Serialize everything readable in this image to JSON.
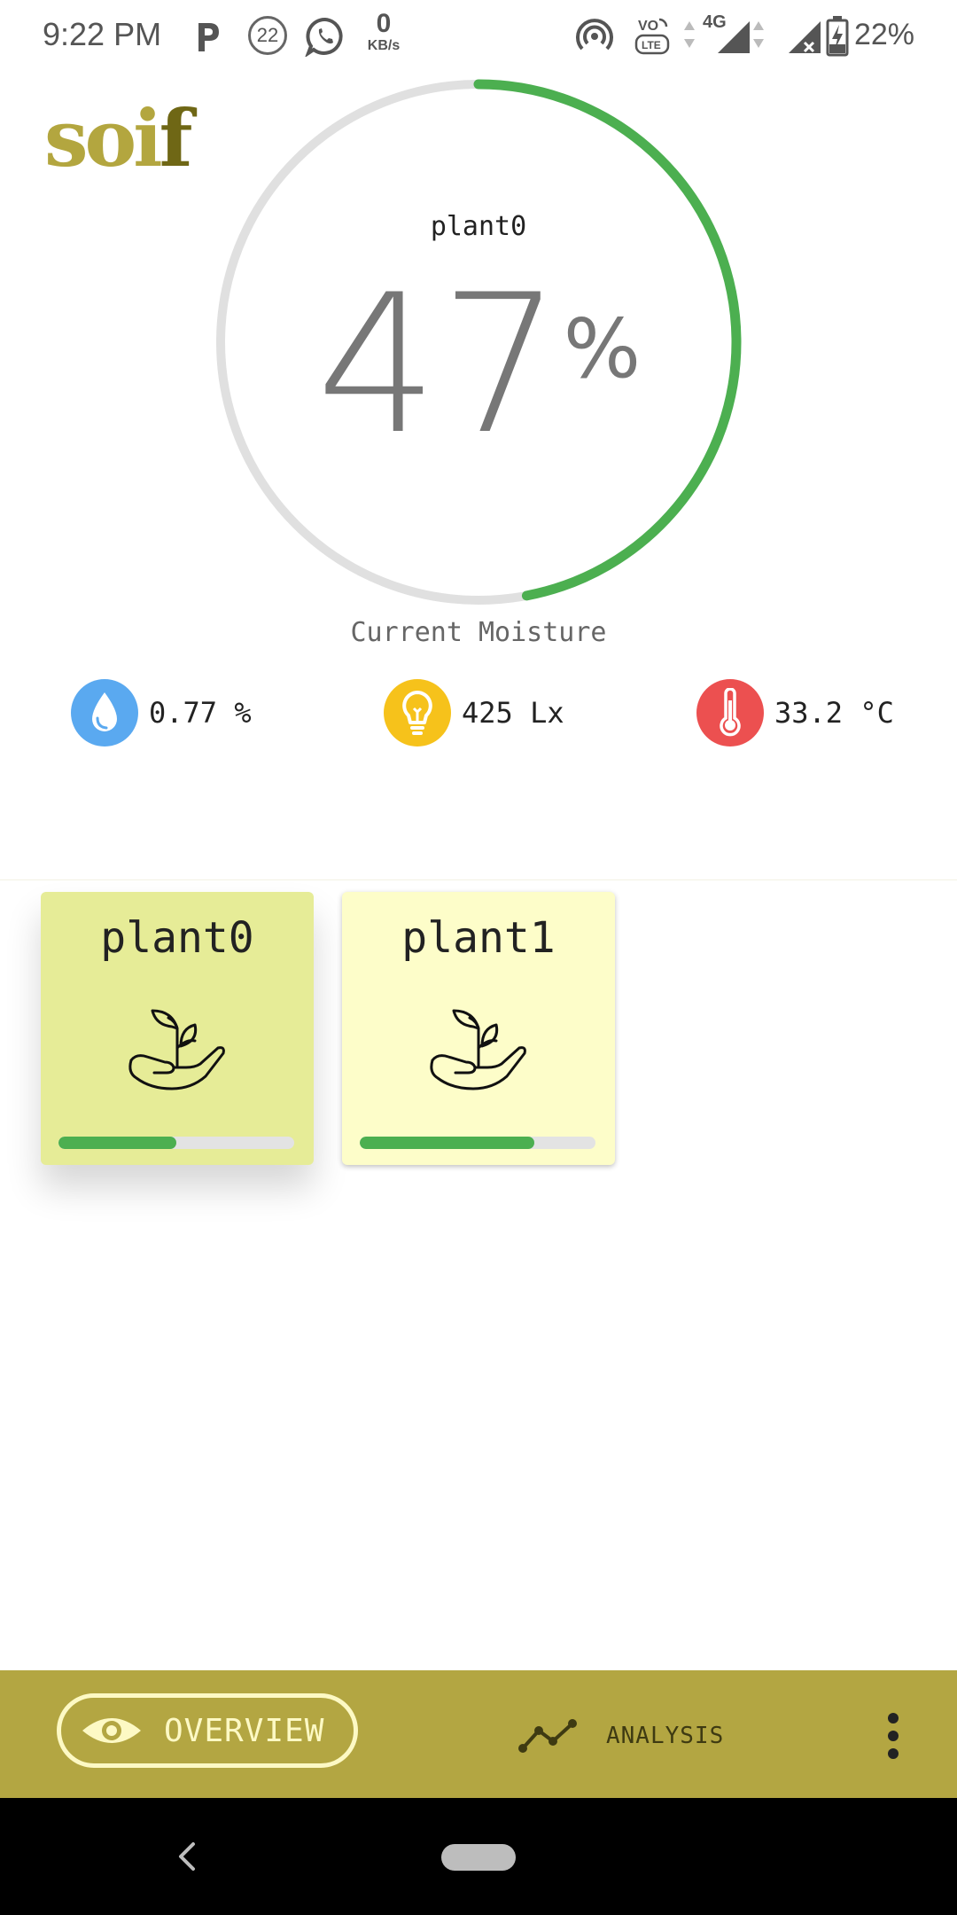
{
  "status_bar": {
    "time": "9:22 PM",
    "notification_count": "22",
    "net_speed_value": "0",
    "net_speed_unit": "KB/s",
    "network_type": "4G",
    "battery_percent": "22%",
    "icons": [
      "p-app-icon",
      "notification-count-icon",
      "whatsapp-icon",
      "hotspot-icon",
      "volte-icon",
      "signal-icon",
      "no-signal-icon",
      "battery-charging-icon"
    ]
  },
  "app": {
    "logo_part1": "soi",
    "logo_part2": "f",
    "colors": {
      "brand": "#b3a642",
      "accent_green": "#4caf50",
      "track_gray": "#e0e0e0"
    }
  },
  "gauge": {
    "plant_name": "plant0",
    "value": "47",
    "value_fraction": 0.47,
    "unit": "%",
    "caption": "Current Moisture"
  },
  "metrics": [
    {
      "icon": "water-drop-icon",
      "value": "0.77 %",
      "color": "#5aa9f0"
    },
    {
      "icon": "lightbulb-icon",
      "value": "425 Lx",
      "color": "#f6c21b"
    },
    {
      "icon": "thermometer-icon",
      "value": "33.2 °C",
      "color": "#ec5050"
    }
  ],
  "plants": [
    {
      "name": "plant0",
      "icon": "plant-in-hand-icon",
      "moisture_fraction": 0.5,
      "selected": true
    },
    {
      "name": "plant1",
      "icon": "plant-in-hand-icon",
      "moisture_fraction": 0.74,
      "selected": false
    }
  ],
  "bottom_nav": {
    "overview_label": "OVERVIEW",
    "analysis_label": "ANALYSIS",
    "icons": [
      "eye-icon",
      "trend-line-icon",
      "more-vert-icon"
    ]
  }
}
